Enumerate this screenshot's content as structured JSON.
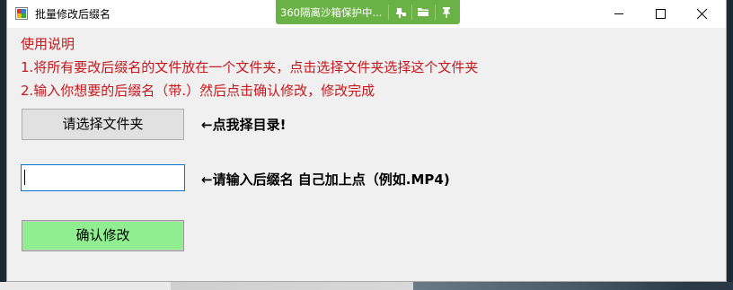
{
  "window": {
    "title": "批量修改后缀名"
  },
  "sandbox_bar": {
    "text": "360隔离沙箱保护中..."
  },
  "instructions": {
    "heading": "使用说明",
    "line1": "1.将所有要改后缀名的文件放在一个文件夹，点击选择文件夹选择这个文件夹",
    "line2": "2.输入你想要的后缀名（带.）然后点击确认修改，修改完成"
  },
  "select_folder": {
    "button_label": "请选择文件夹",
    "hint": "←点我择目录!"
  },
  "suffix": {
    "value": "",
    "hint": "←请输入后缀名  自己加上点（例如.MP4)"
  },
  "confirm": {
    "button_label": "确认修改"
  },
  "colors": {
    "instruction_text": "#c8171c",
    "sandbox_bar": "#6ab245",
    "confirm_button": "#90ee90",
    "input_border": "#0078d7"
  },
  "icons": {
    "app": "app-icon",
    "sandbox": [
      "pin-settings-icon",
      "folder-icon",
      "pin-icon"
    ],
    "window_controls": [
      "minimize-icon",
      "maximize-icon",
      "close-icon"
    ]
  }
}
